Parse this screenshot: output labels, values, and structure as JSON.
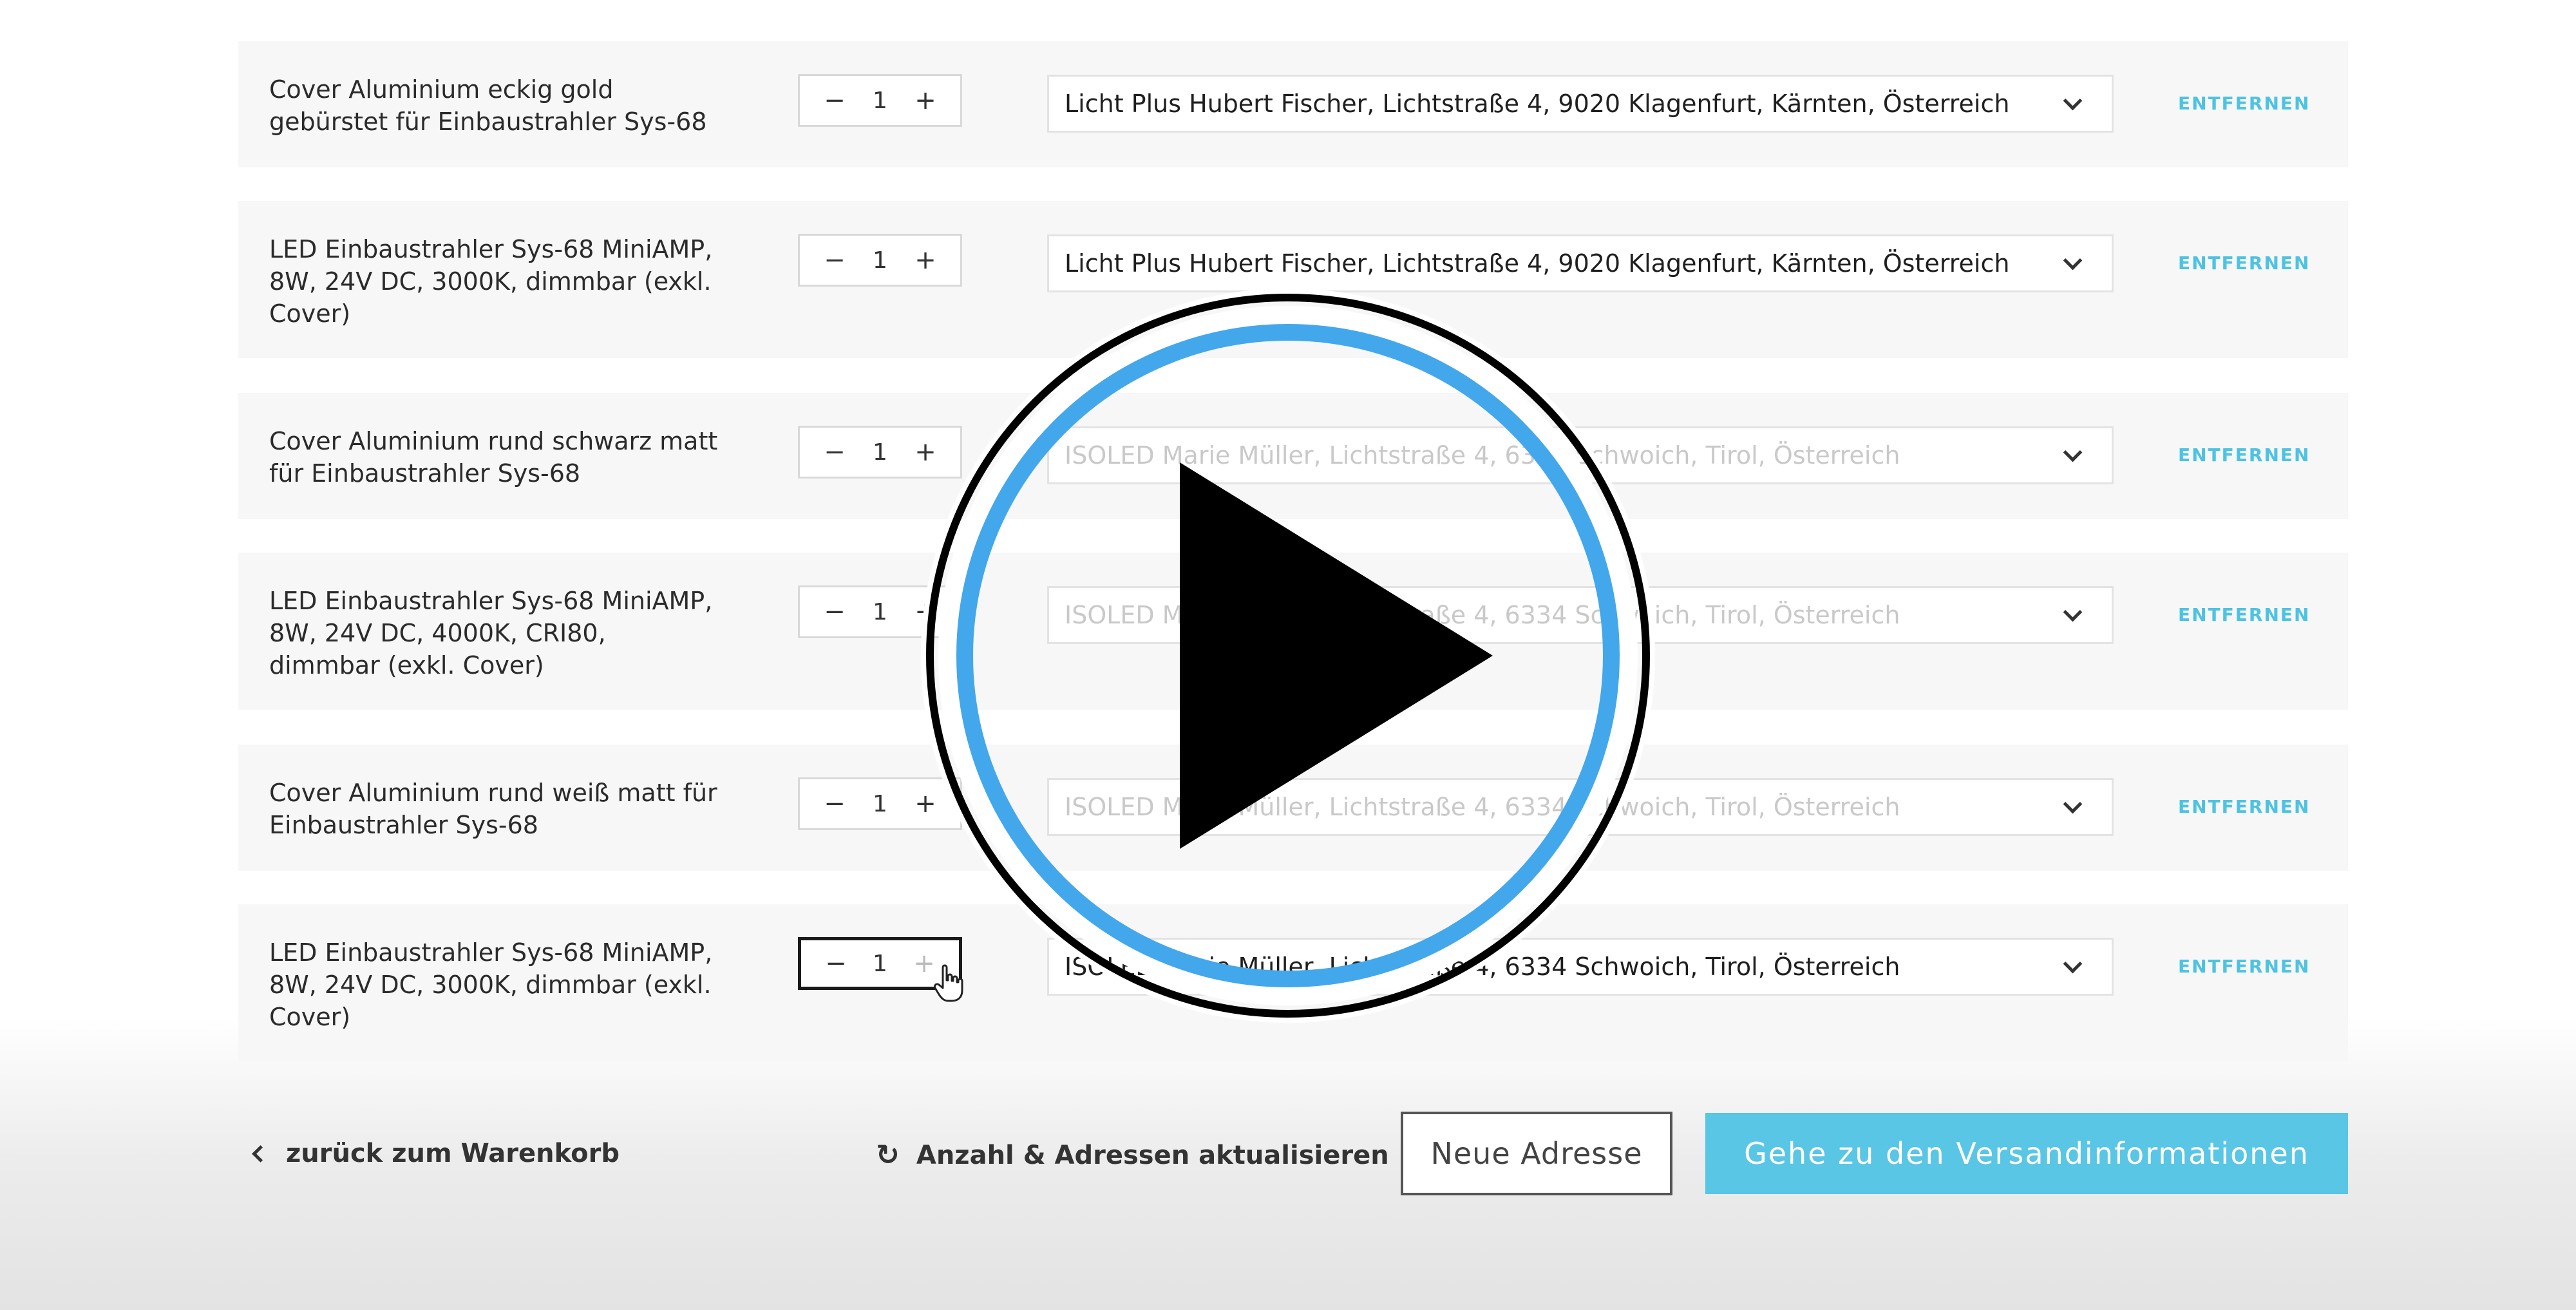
{
  "items": [
    {
      "product": "Cover Aluminium eckig gold\ngebürstet für Einbaustrahler Sys-68",
      "qty": "1",
      "address": "Licht Plus Hubert Fischer, Lichtstraße 4, 9020 Klagenfurt, Kärnten, Österreich",
      "remove": "ENTFERNEN"
    },
    {
      "product": "LED Einbaustrahler Sys-68 MiniAMP,\n8W, 24V DC, 3000K, dimmbar (exkl.\nCover)",
      "qty": "1",
      "address": "Licht Plus Hubert Fischer, Lichtstraße 4, 9020 Klagenfurt, Kärnten, Österreich",
      "remove": "ENTFERNEN"
    },
    {
      "product": "Cover Aluminium rund schwarz matt\nfür Einbaustrahler Sys-68",
      "qty": "1",
      "address": "ISOLED Marie Müller, Lichtstraße 4, 6334 Schwoich, Tirol, Österreich",
      "remove": "ENTFERNEN"
    },
    {
      "product": "LED Einbaustrahler Sys-68 MiniAMP,\n8W, 24V DC, 4000K, CRI80,\ndimmbar (exkl. Cover)",
      "qty": "1",
      "address": "ISOLED Marie Müller, Lichtstraße 4, 6334 Schwoich, Tirol, Österreich",
      "remove": "ENTFERNEN"
    },
    {
      "product": "Cover Aluminium rund weiß matt für\nEinbaustrahler Sys-68",
      "qty": "1",
      "address": "ISOLED Marie Müller, Lichtstraße 4, 6334 Schwoich, Tirol, Österreich",
      "remove": "ENTFERNEN"
    },
    {
      "product": "LED Einbaustrahler Sys-68 MiniAMP,\n8W, 24V DC, 3000K, dimmbar (exkl.\nCover)",
      "qty": "1",
      "address": "ISOLED Marie Müller, Lichtstraße 4, 6334 Schwoich, Tirol, Österreich",
      "remove": "ENTFERNEN"
    }
  ],
  "stepper": {
    "minus": "−",
    "plus": "+"
  },
  "footer": {
    "back_label": "zurück zum Warenkorb",
    "refresh_label": "Anzahl & Adressen aktualisieren",
    "new_address_label": "Neue Adresse",
    "continue_label": "Gehe zu den Versandinformationen"
  },
  "colors": {
    "accent": "#58c6e4",
    "remove_link": "#4cc3e2",
    "row_background": "#f7f7f7",
    "play_ring": "#43a7ec"
  },
  "icons": {
    "back": "chevron-left-icon",
    "refresh": "refresh-icon",
    "select": "chevron-down-icon",
    "cursor": "hand-pointer-icon",
    "video": "play-icon"
  }
}
